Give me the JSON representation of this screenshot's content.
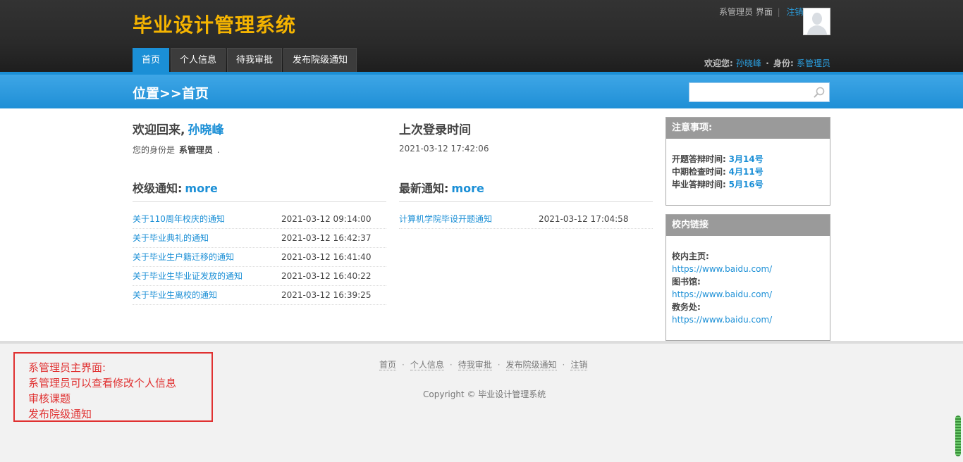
{
  "header": {
    "site_title": "毕业设计管理系统",
    "role_page": "系管理员 界面",
    "logout": "注销",
    "nav": [
      "首页",
      "个人信息",
      "待我审批",
      "发布院级通知"
    ],
    "welcome_label": "欢迎您:",
    "username": "孙晓峰",
    "identity_label": "身份:",
    "identity": "系管理员"
  },
  "locbar": {
    "title": "位置>>首页",
    "search_placeholder": ""
  },
  "welcome": {
    "heading": "欢迎回来,",
    "name": "孙晓峰",
    "role_prefix": "您的身份是",
    "role": "系管理员",
    "role_suffix": "."
  },
  "last_login": {
    "heading": "上次登录时间",
    "time": "2021-03-12  17:42:06"
  },
  "school_notices": {
    "heading": "校级通知:",
    "more": "more",
    "items": [
      {
        "title": "关于110周年校庆的通知",
        "date": "2021-03-12 09:14:00"
      },
      {
        "title": "关于毕业典礼的通知",
        "date": "2021-03-12 16:42:37"
      },
      {
        "title": "关于毕业生户籍迁移的通知",
        "date": "2021-03-12 16:41:40"
      },
      {
        "title": "关于毕业生毕业证发放的通知",
        "date": "2021-03-12 16:40:22"
      },
      {
        "title": "关于毕业生离校的通知",
        "date": "2021-03-12 16:39:25"
      }
    ]
  },
  "latest_notices": {
    "heading": "最新通知:",
    "more": "more",
    "items": [
      {
        "title": "计算机学院毕设开题通知",
        "date": "2021-03-12 17:04:58"
      }
    ]
  },
  "notes_box": {
    "heading": "注意事项:",
    "items": [
      {
        "label": "开题答辩时间:",
        "value": "3月14号"
      },
      {
        "label": "中期检查时间:",
        "value": "4月11号"
      },
      {
        "label": "毕业答辩时间:",
        "value": "5月16号"
      }
    ]
  },
  "links_box": {
    "heading": "校内链接",
    "items": [
      {
        "label": "校内主页:",
        "url": "https://www.baidu.com/"
      },
      {
        "label": "图书馆:",
        "url": "https://www.baidu.com/"
      },
      {
        "label": "教务处:",
        "url": "https://www.baidu.com/"
      }
    ]
  },
  "footer": {
    "links": [
      "首页",
      "个人信息",
      "待我审批",
      "发布院级通知",
      "注销"
    ],
    "sep": "·",
    "copyright": "Copyright © 毕业设计管理系统"
  },
  "annotation": {
    "lines": [
      "系管理员主界面:",
      "系管理员可以查看修改个人信息",
      "审核课题",
      "发布院级通知"
    ]
  },
  "colors": {
    "accent": "#1b8fd6",
    "title": "#f5b400",
    "annotation": "#e03131"
  }
}
